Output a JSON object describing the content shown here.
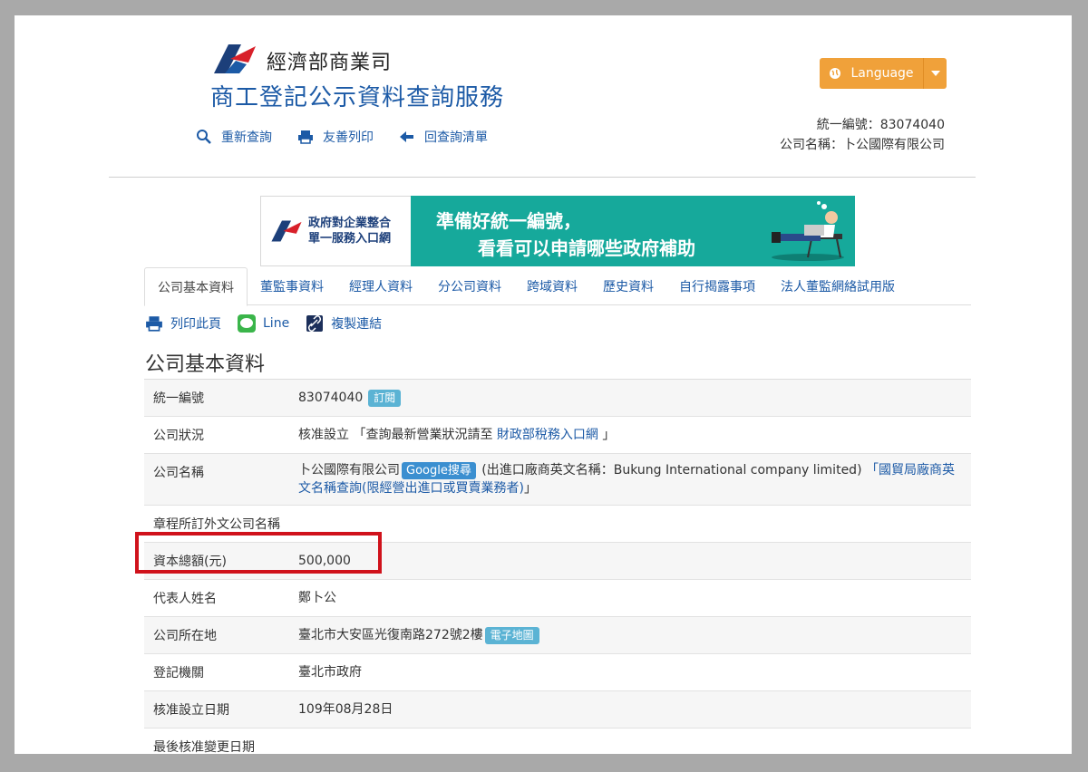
{
  "header": {
    "brand_name": "經濟部商業司",
    "service_title": "商工登記公示資料查詢服務",
    "tools": [
      {
        "label": "重新查詢",
        "icon": "search-icon"
      },
      {
        "label": "友善列印",
        "icon": "printer-icon"
      },
      {
        "label": "回查詢清單",
        "icon": "arrow-left-icon"
      }
    ],
    "language_label": "Language",
    "company_id_line": "統一編號：83074040",
    "company_name_line": "公司名稱：卜公國際有限公司"
  },
  "banner": {
    "left_line1": "政府對企業整合",
    "left_line2": "單一服務入口網",
    "right_line1": "準備好統一編號，",
    "right_line2": "看看可以申請哪些政府補助"
  },
  "tabs": [
    {
      "label": "公司基本資料",
      "active": true
    },
    {
      "label": "董監事資料",
      "active": false
    },
    {
      "label": "經理人資料",
      "active": false
    },
    {
      "label": "分公司資料",
      "active": false
    },
    {
      "label": "跨域資料",
      "active": false
    },
    {
      "label": "歷史資料",
      "active": false
    },
    {
      "label": "自行揭露事項",
      "active": false
    },
    {
      "label": "法人董監網絡試用版",
      "active": false
    }
  ],
  "actions": {
    "print": "列印此頁",
    "line": "Line",
    "copy": "複製連結"
  },
  "section_title": "公司基本資料",
  "table": {
    "tax_id": {
      "label": "統一編號",
      "value": "83074040",
      "tag": "訂閱"
    },
    "status": {
      "label": "公司狀況",
      "value_prefix": "核准設立 「查詢最新營業狀況請至 ",
      "link": "財政部稅務入口網",
      "value_suffix": " 」"
    },
    "name": {
      "label": "公司名稱",
      "value": "卜公國際有限公司",
      "google_tag": "Google搜尋",
      "english_text": " (出進口廠商英文名稱：Bukung International company limited) ",
      "link": "「國貿局廠商英文名稱查詢(限經營出進口或買賣業務者)",
      "suffix": "」"
    },
    "foreign_name": {
      "label": "章程所訂外文公司名稱",
      "value": ""
    },
    "capital": {
      "label": "資本總額(元)",
      "value": "500,000"
    },
    "representative": {
      "label": "代表人姓名",
      "value": "鄭卜公"
    },
    "address": {
      "label": "公司所在地",
      "value": "臺北市大安區光復南路272號2樓",
      "tag": "電子地圖"
    },
    "authority": {
      "label": "登記機關",
      "value": "臺北市政府"
    },
    "established": {
      "label": "核准設立日期",
      "value": "109年08月28日"
    },
    "last_change": {
      "label": "最後核准變更日期",
      "value": ""
    }
  },
  "colors": {
    "brand_blue": "#1c5aa6",
    "accent_orange": "#f0a13a",
    "banner_teal": "#16a99b",
    "highlight_red": "#d0121b"
  }
}
